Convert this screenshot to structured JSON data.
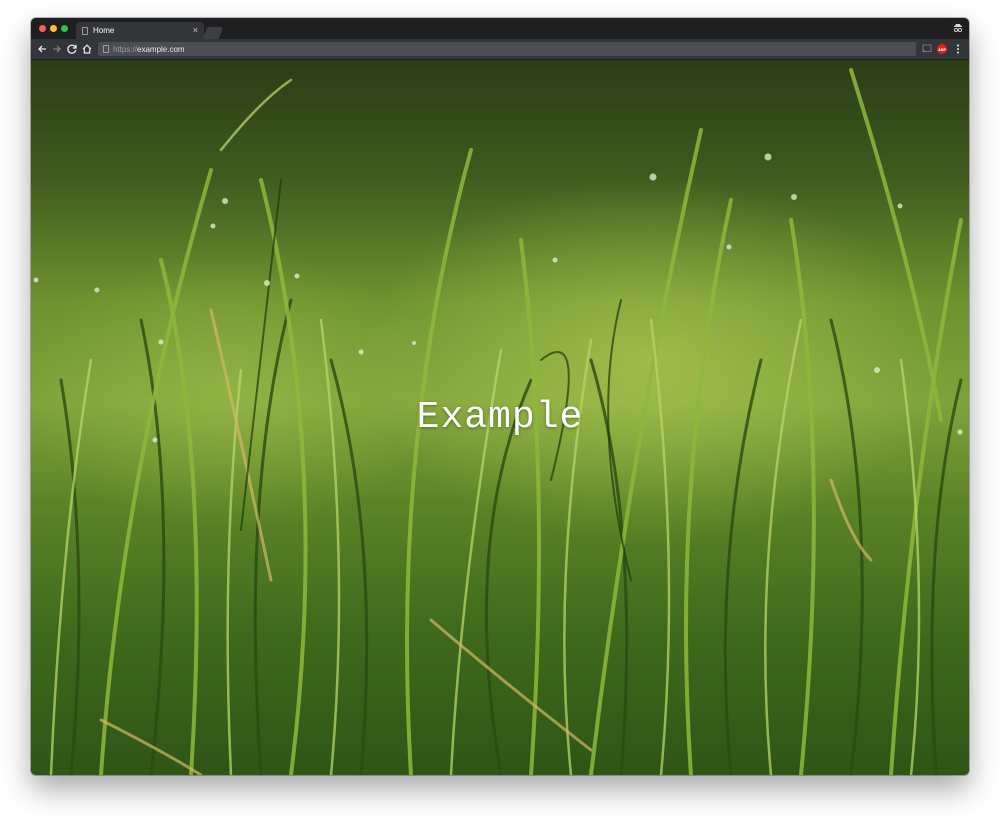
{
  "browser": {
    "tab": {
      "title": "Home",
      "close_glyph": "×",
      "favicon": "page-icon"
    },
    "address_bar": {
      "scheme": "https://",
      "host": "example.com",
      "icon": "page-icon"
    },
    "toolbar_icons": [
      "back-icon",
      "forward-icon",
      "reload-icon",
      "home-icon"
    ],
    "extensions": {
      "cast": "cast-icon",
      "adblock_label": "ABP"
    },
    "profile_icon": "incognito-icon",
    "menu_icon": "more-vert-icon"
  },
  "page": {
    "heading": "Example",
    "background": "grass-photo"
  },
  "colors": {
    "tab_active": "#323639",
    "titlebar": "#1f1f21",
    "close_red": "#ff5f57",
    "minimize_yellow": "#febc2e",
    "zoom_green": "#28c840",
    "adblock_red": "#e2231a"
  }
}
